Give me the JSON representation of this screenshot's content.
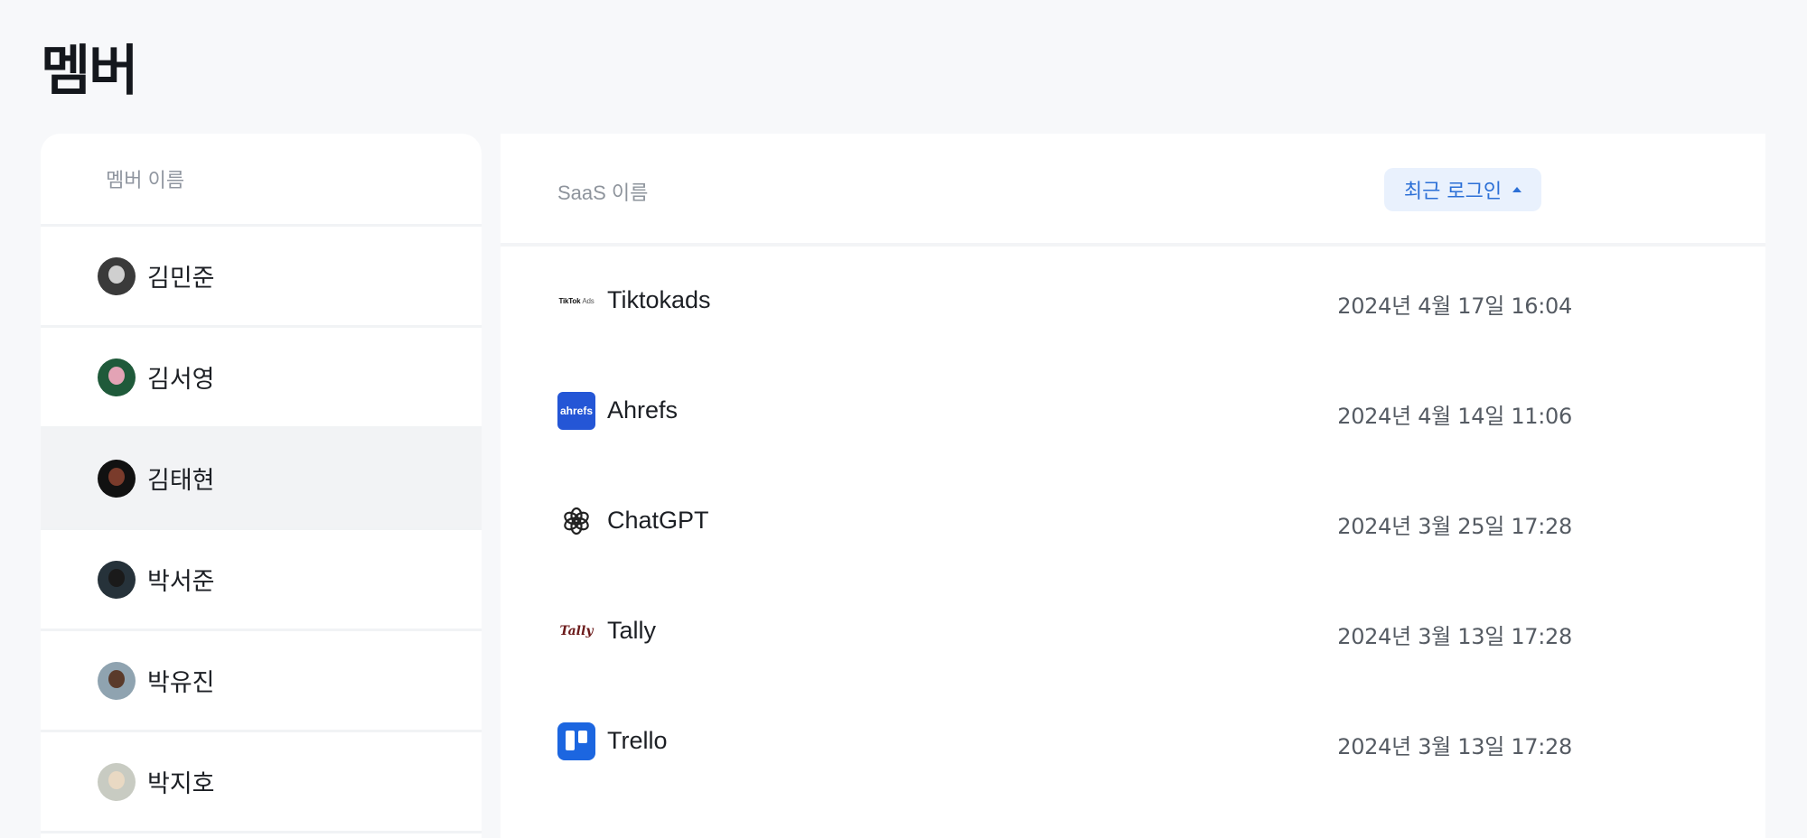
{
  "page": {
    "title": "멤버"
  },
  "members": {
    "header": "멤버 이름",
    "items": [
      {
        "name": "김민준",
        "avatar_bg": "#3a3a3a",
        "face": "#cfcfcf",
        "selected": false
      },
      {
        "name": "김서영",
        "avatar_bg": "#1f5a3a",
        "face": "#e3a3b5",
        "selected": false
      },
      {
        "name": "김태현",
        "avatar_bg": "#111111",
        "face": "#7a3b2b",
        "selected": true
      },
      {
        "name": "박서준",
        "avatar_bg": "#26323a",
        "face": "#1a1a1a",
        "selected": false
      },
      {
        "name": "박유진",
        "avatar_bg": "#8fa3b0",
        "face": "#5a3a2a",
        "selected": false
      },
      {
        "name": "박지호",
        "avatar_bg": "#c8cbc2",
        "face": "#e9d9c3",
        "selected": false
      }
    ]
  },
  "saas": {
    "header": "SaaS 이름",
    "sort_button": {
      "label": "최근 로그인",
      "direction": "ascending"
    },
    "rows": [
      {
        "name": "Tiktokads",
        "last_login": "2024년 4월 17일 16:04",
        "logo": "tiktok-ads-logo-icon",
        "logo_text": "TikTok",
        "logo_subtext": "Ads"
      },
      {
        "name": "Ahrefs",
        "last_login": "2024년 4월 14일 11:06",
        "logo": "ahrefs-logo-icon",
        "logo_text": "ahrefs"
      },
      {
        "name": "ChatGPT",
        "last_login": "2024년 3월 25일 17:28",
        "logo": "openai-logo-icon"
      },
      {
        "name": "Tally",
        "last_login": "2024년 3월 13일 17:28",
        "logo": "tally-logo-icon",
        "logo_text": "Tally"
      },
      {
        "name": "Trello",
        "last_login": "2024년 3월 13일 17:28",
        "logo": "trello-logo-icon"
      }
    ]
  },
  "colors": {
    "background": "#f7f8fa",
    "panel": "#ffffff",
    "accent": "#2b6fd6",
    "accent_bg": "#e9f1fd",
    "selected_row": "#f2f3f5"
  }
}
